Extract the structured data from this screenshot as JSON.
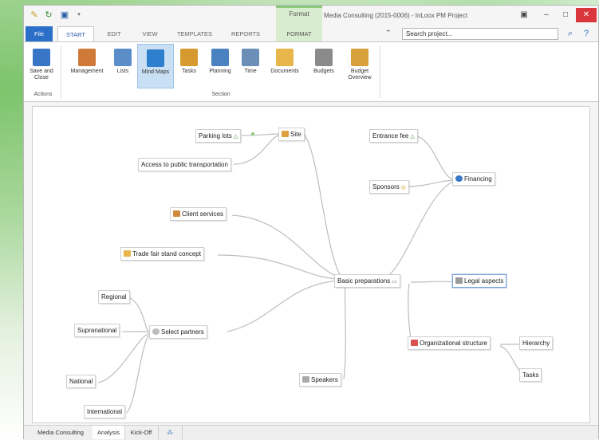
{
  "window": {
    "title": "Media Consulting (2015-0006) - InLoox PM Project",
    "context_tab_caption": "Format"
  },
  "tabs": [
    "File",
    "START",
    "EDIT",
    "VIEW",
    "TEMPLATES",
    "REPORTS",
    "FORMAT"
  ],
  "search": {
    "placeholder": "Search project..."
  },
  "ribbon": {
    "actions": {
      "label": "Save and Close",
      "group": "Actions"
    },
    "section_items": [
      "Management",
      "Lists",
      "Mind Maps",
      "Tasks",
      "Planning",
      "Time",
      "Documents",
      "Budgets",
      "Budget Overview"
    ],
    "section_group": "Section",
    "selected": "Mind Maps"
  },
  "mindmap": {
    "nodes": {
      "parking": "Parking lots",
      "site": "Site",
      "transport": "Access to public transportation",
      "entrance": "Entrance fee",
      "sponsors": "Sponsors",
      "financing": "Financing",
      "client": "Client services",
      "tradefair": "Trade fair stand concept",
      "basic": "Basic preparations",
      "legal": "Legal aspects",
      "regional": "Regional",
      "supranational": "Supranational",
      "partners": "Select partners",
      "national": "National",
      "international": "International",
      "speakers": "Speakers",
      "org": "Organizational structure",
      "hierarchy": "Hierarchy",
      "tasks": "Tasks"
    }
  },
  "bottom_tabs": [
    "Media Consulting",
    "Analysis",
    "Kick-Off"
  ],
  "colors": {
    "accent": "#2b6fc8",
    "context": "#d8ecce",
    "close": "#d9363e"
  }
}
